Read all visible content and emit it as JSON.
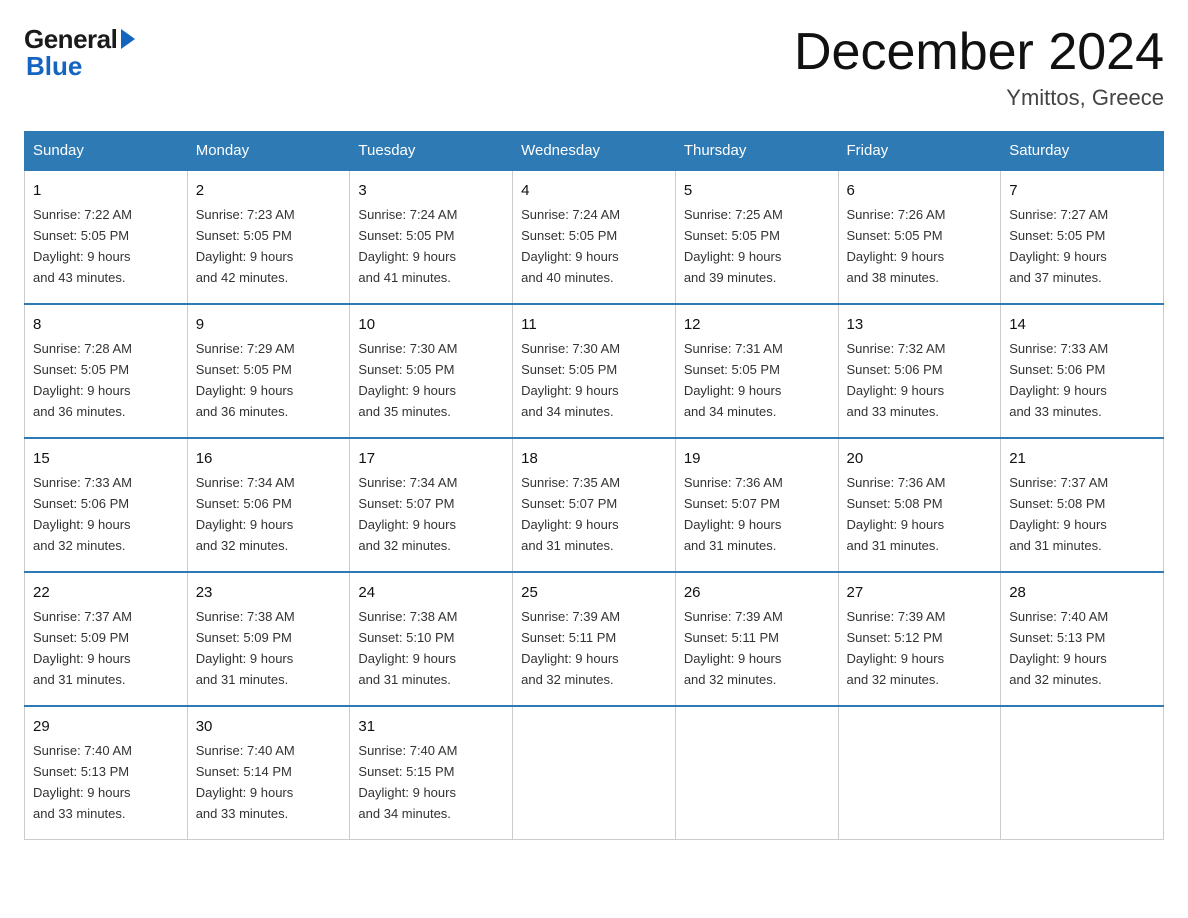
{
  "logo": {
    "general": "General",
    "blue": "Blue"
  },
  "title": "December 2024",
  "subtitle": "Ymittos, Greece",
  "headers": [
    "Sunday",
    "Monday",
    "Tuesday",
    "Wednesday",
    "Thursday",
    "Friday",
    "Saturday"
  ],
  "weeks": [
    [
      {
        "day": "1",
        "sunrise": "7:22 AM",
        "sunset": "5:05 PM",
        "daylight": "9 hours and 43 minutes."
      },
      {
        "day": "2",
        "sunrise": "7:23 AM",
        "sunset": "5:05 PM",
        "daylight": "9 hours and 42 minutes."
      },
      {
        "day": "3",
        "sunrise": "7:24 AM",
        "sunset": "5:05 PM",
        "daylight": "9 hours and 41 minutes."
      },
      {
        "day": "4",
        "sunrise": "7:24 AM",
        "sunset": "5:05 PM",
        "daylight": "9 hours and 40 minutes."
      },
      {
        "day": "5",
        "sunrise": "7:25 AM",
        "sunset": "5:05 PM",
        "daylight": "9 hours and 39 minutes."
      },
      {
        "day": "6",
        "sunrise": "7:26 AM",
        "sunset": "5:05 PM",
        "daylight": "9 hours and 38 minutes."
      },
      {
        "day": "7",
        "sunrise": "7:27 AM",
        "sunset": "5:05 PM",
        "daylight": "9 hours and 37 minutes."
      }
    ],
    [
      {
        "day": "8",
        "sunrise": "7:28 AM",
        "sunset": "5:05 PM",
        "daylight": "9 hours and 36 minutes."
      },
      {
        "day": "9",
        "sunrise": "7:29 AM",
        "sunset": "5:05 PM",
        "daylight": "9 hours and 36 minutes."
      },
      {
        "day": "10",
        "sunrise": "7:30 AM",
        "sunset": "5:05 PM",
        "daylight": "9 hours and 35 minutes."
      },
      {
        "day": "11",
        "sunrise": "7:30 AM",
        "sunset": "5:05 PM",
        "daylight": "9 hours and 34 minutes."
      },
      {
        "day": "12",
        "sunrise": "7:31 AM",
        "sunset": "5:05 PM",
        "daylight": "9 hours and 34 minutes."
      },
      {
        "day": "13",
        "sunrise": "7:32 AM",
        "sunset": "5:06 PM",
        "daylight": "9 hours and 33 minutes."
      },
      {
        "day": "14",
        "sunrise": "7:33 AM",
        "sunset": "5:06 PM",
        "daylight": "9 hours and 33 minutes."
      }
    ],
    [
      {
        "day": "15",
        "sunrise": "7:33 AM",
        "sunset": "5:06 PM",
        "daylight": "9 hours and 32 minutes."
      },
      {
        "day": "16",
        "sunrise": "7:34 AM",
        "sunset": "5:06 PM",
        "daylight": "9 hours and 32 minutes."
      },
      {
        "day": "17",
        "sunrise": "7:34 AM",
        "sunset": "5:07 PM",
        "daylight": "9 hours and 32 minutes."
      },
      {
        "day": "18",
        "sunrise": "7:35 AM",
        "sunset": "5:07 PM",
        "daylight": "9 hours and 31 minutes."
      },
      {
        "day": "19",
        "sunrise": "7:36 AM",
        "sunset": "5:07 PM",
        "daylight": "9 hours and 31 minutes."
      },
      {
        "day": "20",
        "sunrise": "7:36 AM",
        "sunset": "5:08 PM",
        "daylight": "9 hours and 31 minutes."
      },
      {
        "day": "21",
        "sunrise": "7:37 AM",
        "sunset": "5:08 PM",
        "daylight": "9 hours and 31 minutes."
      }
    ],
    [
      {
        "day": "22",
        "sunrise": "7:37 AM",
        "sunset": "5:09 PM",
        "daylight": "9 hours and 31 minutes."
      },
      {
        "day": "23",
        "sunrise": "7:38 AM",
        "sunset": "5:09 PM",
        "daylight": "9 hours and 31 minutes."
      },
      {
        "day": "24",
        "sunrise": "7:38 AM",
        "sunset": "5:10 PM",
        "daylight": "9 hours and 31 minutes."
      },
      {
        "day": "25",
        "sunrise": "7:39 AM",
        "sunset": "5:11 PM",
        "daylight": "9 hours and 32 minutes."
      },
      {
        "day": "26",
        "sunrise": "7:39 AM",
        "sunset": "5:11 PM",
        "daylight": "9 hours and 32 minutes."
      },
      {
        "day": "27",
        "sunrise": "7:39 AM",
        "sunset": "5:12 PM",
        "daylight": "9 hours and 32 minutes."
      },
      {
        "day": "28",
        "sunrise": "7:40 AM",
        "sunset": "5:13 PM",
        "daylight": "9 hours and 32 minutes."
      }
    ],
    [
      {
        "day": "29",
        "sunrise": "7:40 AM",
        "sunset": "5:13 PM",
        "daylight": "9 hours and 33 minutes."
      },
      {
        "day": "30",
        "sunrise": "7:40 AM",
        "sunset": "5:14 PM",
        "daylight": "9 hours and 33 minutes."
      },
      {
        "day": "31",
        "sunrise": "7:40 AM",
        "sunset": "5:15 PM",
        "daylight": "9 hours and 34 minutes."
      },
      null,
      null,
      null,
      null
    ]
  ]
}
